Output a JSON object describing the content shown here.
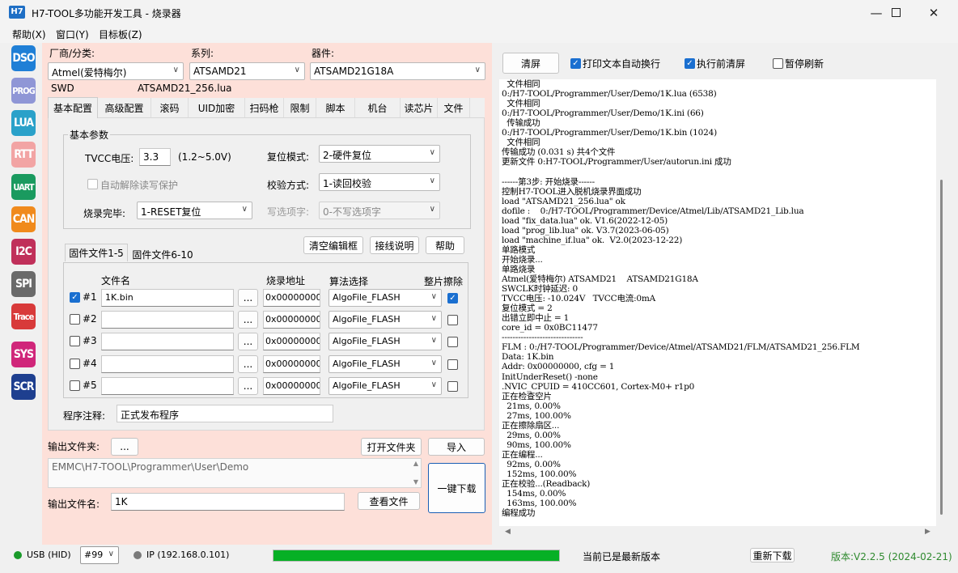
{
  "window": {
    "title": "H7-TOOL多功能开发工具 - 烧录器",
    "icon_text": "H7"
  },
  "menu": [
    "帮助(X)",
    "窗口(Y)",
    "目标板(Z)"
  ],
  "sidebar": [
    {
      "label": "DSO",
      "color": "#1f7fd6"
    },
    {
      "label": "PROG",
      "color": "#8f96d6"
    },
    {
      "label": "LUA",
      "color": "#2aa1c9"
    },
    {
      "label": "RTT",
      "color": "#f2a4a4"
    },
    {
      "label": "UART",
      "color": "#1a9a5f"
    },
    {
      "label": "CAN",
      "color": "#f08a1c"
    },
    {
      "label": "I2C",
      "color": "#c0305a"
    },
    {
      "label": "SPI",
      "color": "#6a6a6a"
    },
    {
      "label": "Trace",
      "color": "#d83a3a"
    },
    {
      "label": "SYS",
      "color": "#d0267a"
    },
    {
      "label": "SCR",
      "color": "#1e3f8f"
    }
  ],
  "device": {
    "vendor_label": "厂商/分类:",
    "vendor_value": "Atmel(爱特梅尔)",
    "series_label": "系列:",
    "series_value": "ATSAMD21",
    "part_label": "器件:",
    "part_value": "ATSAMD21G18A",
    "interface": "SWD",
    "lua_file": "ATSAMD21_256.lua"
  },
  "tabs": [
    "基本配置",
    "高级配置",
    "滚码",
    "UID加密",
    "扫码枪",
    "限制",
    "脚本",
    "机台",
    "读芯片",
    "文件"
  ],
  "basic": {
    "group_title": "基本参数",
    "tvcc_label": "TVCC电压:",
    "tvcc_value": "3.3",
    "tvcc_range": "(1.2~5.0V)",
    "reset_label": "复位模式:",
    "reset_value": "2-硬件复位",
    "auto_unlock_label": "自动解除读写保护",
    "verify_label": "校验方式:",
    "verify_value": "1-读回校验",
    "finish_label": "烧录完毕:",
    "finish_value": "1-RESET复位",
    "write_opt_label": "写选项字:",
    "write_opt_value": "0-不写选项字"
  },
  "file_tabs": [
    "固件文件1-5",
    "固件文件6-10"
  ],
  "file_buttons": {
    "clear": "清空编辑框",
    "wiring": "接线说明",
    "help": "帮助"
  },
  "file_headers": {
    "name": "文件名",
    "addr": "烧录地址",
    "algo": "算法选择",
    "erase": "整片擦除"
  },
  "files": [
    {
      "id": "#1",
      "enabled": true,
      "name": "1K.bin",
      "addr": "0x00000000",
      "algo": "AlgoFile_FLASH",
      "erase": true
    },
    {
      "id": "#2",
      "enabled": false,
      "name": "",
      "addr": "0x00000000",
      "algo": "AlgoFile_FLASH",
      "erase": false
    },
    {
      "id": "#3",
      "enabled": false,
      "name": "",
      "addr": "0x00000000",
      "algo": "AlgoFile_FLASH",
      "erase": false
    },
    {
      "id": "#4",
      "enabled": false,
      "name": "",
      "addr": "0x00000000",
      "algo": "AlgoFile_FLASH",
      "erase": false
    },
    {
      "id": "#5",
      "enabled": false,
      "name": "",
      "addr": "0x00000000",
      "algo": "AlgoFile_FLASH",
      "erase": false
    }
  ],
  "browse_label": "...",
  "note": {
    "label": "程序注释:",
    "value": "正式发布程序"
  },
  "output": {
    "folder_label": "输出文件夹:",
    "browse": "...",
    "open_folder": "打开文件夹",
    "import": "导入",
    "path": "EMMC\\H7-TOOL\\Programmer\\User\\Demo",
    "file_label": "输出文件名:",
    "file_value": "1K",
    "view_file": "查看文件",
    "download": "一键下载"
  },
  "log_toolbar": {
    "clear": "清屏",
    "autowrap": "打印文本自动换行",
    "clear_before": "执行前清屏",
    "pause": "暂停刷新"
  },
  "log": [
    "  文件相同",
    "0:/H7-TOOL/Programmer/User/Demo/1K.lua (6538)",
    "  文件相同",
    "0:/H7-TOOL/Programmer/User/Demo/1K.ini (66)",
    "  传输成功",
    "0:/H7-TOOL/Programmer/User/Demo/1K.bin (1024)",
    "  文件相同",
    "传输成功 (0.031 s) 共4个文件",
    "更新文件 0:H7-TOOL/Programmer/User/autorun.ini 成功",
    "",
    "------第3步: 开始烧录------",
    "控制H7-TOOL进入脱机烧录界面成功",
    "load \"ATSAMD21_256.lua\" ok",
    "dofile :    0:/H7-TOOL/Programmer/Device/Atmel/Lib/ATSAMD21_Lib.lua",
    "load \"fix_data.lua\" ok. V1.6(2022-12-05)",
    "load \"prog_lib.lua\" ok. V3.7(2023-06-05)",
    "load \"machine_if.lua\" ok.  V2.0(2023-12-22)",
    "单路模式",
    "开始烧录...",
    "单路烧录",
    "Atmel(爱特梅尔) ATSAMD21    ATSAMD21G18A",
    "SWCLK时钟延迟: 0",
    "TVCC电压: -10.024V   TVCC电流:0mA",
    "复位模式 = 2",
    "出错立即中止 = 1",
    "core_id = 0x0BC11477",
    "------------------------------",
    "FLM : 0:/H7-TOOL/Programmer/Device/Atmel/ATSAMD21/FLM/ATSAMD21_256.FLM",
    "Data: 1K.bin",
    "Addr: 0x00000000, cfg = 1",
    "InitUnderReset() -none",
    ".NVIC_CPUID = 410CC601, Cortex-M0+ r1p0",
    "正在检查空片",
    "  21ms, 0.00%",
    "  27ms, 100.00%",
    "正在擦除扇区...",
    "  29ms, 0.00%",
    "  90ms, 100.00%",
    "正在编程...",
    "  92ms, 0.00%",
    "  152ms, 100.00%",
    "正在校验...(Readback)",
    "  154ms, 0.00%",
    "  163ms, 100.00%",
    "编程成功"
  ],
  "status": {
    "usb": "USB (HID)",
    "port": "#99",
    "ip": "IP (192.168.0.101)",
    "progress": 1.0,
    "message": "当前已是最新版本",
    "redownload": "重新下载",
    "version": "版本:V2.2.5 (2024-02-21)"
  }
}
